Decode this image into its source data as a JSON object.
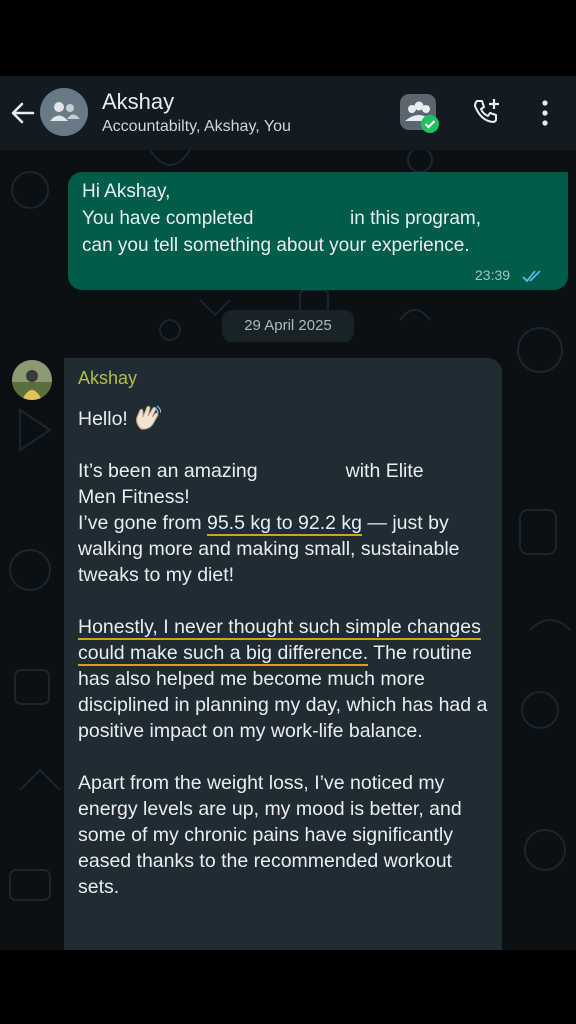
{
  "header": {
    "title": "Akshay",
    "subtitle": "Accountabilty, Akshay, You"
  },
  "outgoing": {
    "line1": "Hi Akshay,",
    "line2a": "You have completed",
    "line2b": "in this program,",
    "line3": "can you tell something about your experience.",
    "time": "23:39"
  },
  "date_chip": "29 April 2025",
  "incoming": {
    "sender": "Akshay",
    "greeting": "Hello!",
    "p1_a": "It’s been an amazing",
    "p1_b": "with Elite",
    "p1_c": "Men Fitness!",
    "p1_d": "I’ve gone from ",
    "p1_hl": "95.5 kg to 92.2 kg",
    "p1_e": " — just by walking more and making small, sustainable tweaks to my diet!",
    "p2_hl": "Honestly, I never thought such simple changes could make such a big difference.",
    "p2_rest": " The routine has also helped me become much more disciplined in planning my day, which has had a positive impact on my work-life balance.",
    "p3": "Apart from the weight loss, I’ve noticed my energy levels are up, my mood is better, and some of my chronic pains have significantly eased thanks to the recommended workout sets."
  },
  "colors": {
    "outgoing_bubble": "#005c4b",
    "incoming_bubble": "#202c33",
    "sender_name": "#b4bd45",
    "highlight_underline": "#d4a21a",
    "read_ticks": "#53bdeb"
  }
}
